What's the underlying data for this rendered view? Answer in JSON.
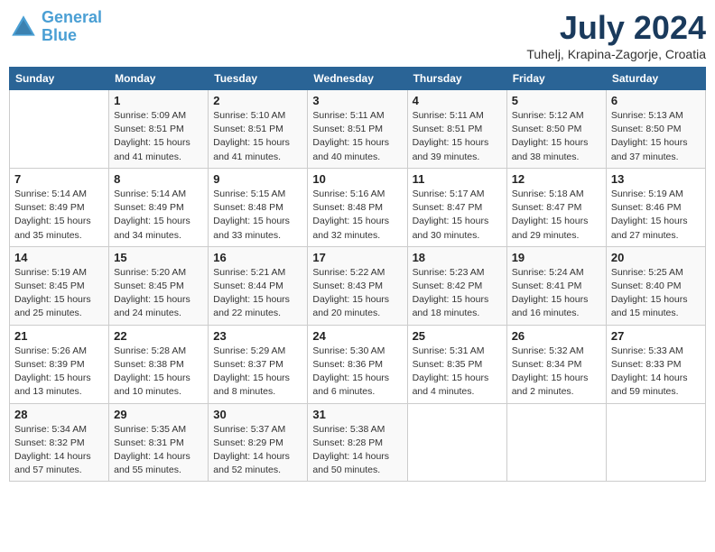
{
  "header": {
    "logo_line1": "General",
    "logo_line2": "Blue",
    "month": "July 2024",
    "location": "Tuhelj, Krapina-Zagorje, Croatia"
  },
  "days_of_week": [
    "Sunday",
    "Monday",
    "Tuesday",
    "Wednesday",
    "Thursday",
    "Friday",
    "Saturday"
  ],
  "weeks": [
    [
      {
        "day": "",
        "info": ""
      },
      {
        "day": "1",
        "info": "Sunrise: 5:09 AM\nSunset: 8:51 PM\nDaylight: 15 hours\nand 41 minutes."
      },
      {
        "day": "2",
        "info": "Sunrise: 5:10 AM\nSunset: 8:51 PM\nDaylight: 15 hours\nand 41 minutes."
      },
      {
        "day": "3",
        "info": "Sunrise: 5:11 AM\nSunset: 8:51 PM\nDaylight: 15 hours\nand 40 minutes."
      },
      {
        "day": "4",
        "info": "Sunrise: 5:11 AM\nSunset: 8:51 PM\nDaylight: 15 hours\nand 39 minutes."
      },
      {
        "day": "5",
        "info": "Sunrise: 5:12 AM\nSunset: 8:50 PM\nDaylight: 15 hours\nand 38 minutes."
      },
      {
        "day": "6",
        "info": "Sunrise: 5:13 AM\nSunset: 8:50 PM\nDaylight: 15 hours\nand 37 minutes."
      }
    ],
    [
      {
        "day": "7",
        "info": "Sunrise: 5:14 AM\nSunset: 8:49 PM\nDaylight: 15 hours\nand 35 minutes."
      },
      {
        "day": "8",
        "info": "Sunrise: 5:14 AM\nSunset: 8:49 PM\nDaylight: 15 hours\nand 34 minutes."
      },
      {
        "day": "9",
        "info": "Sunrise: 5:15 AM\nSunset: 8:48 PM\nDaylight: 15 hours\nand 33 minutes."
      },
      {
        "day": "10",
        "info": "Sunrise: 5:16 AM\nSunset: 8:48 PM\nDaylight: 15 hours\nand 32 minutes."
      },
      {
        "day": "11",
        "info": "Sunrise: 5:17 AM\nSunset: 8:47 PM\nDaylight: 15 hours\nand 30 minutes."
      },
      {
        "day": "12",
        "info": "Sunrise: 5:18 AM\nSunset: 8:47 PM\nDaylight: 15 hours\nand 29 minutes."
      },
      {
        "day": "13",
        "info": "Sunrise: 5:19 AM\nSunset: 8:46 PM\nDaylight: 15 hours\nand 27 minutes."
      }
    ],
    [
      {
        "day": "14",
        "info": "Sunrise: 5:19 AM\nSunset: 8:45 PM\nDaylight: 15 hours\nand 25 minutes."
      },
      {
        "day": "15",
        "info": "Sunrise: 5:20 AM\nSunset: 8:45 PM\nDaylight: 15 hours\nand 24 minutes."
      },
      {
        "day": "16",
        "info": "Sunrise: 5:21 AM\nSunset: 8:44 PM\nDaylight: 15 hours\nand 22 minutes."
      },
      {
        "day": "17",
        "info": "Sunrise: 5:22 AM\nSunset: 8:43 PM\nDaylight: 15 hours\nand 20 minutes."
      },
      {
        "day": "18",
        "info": "Sunrise: 5:23 AM\nSunset: 8:42 PM\nDaylight: 15 hours\nand 18 minutes."
      },
      {
        "day": "19",
        "info": "Sunrise: 5:24 AM\nSunset: 8:41 PM\nDaylight: 15 hours\nand 16 minutes."
      },
      {
        "day": "20",
        "info": "Sunrise: 5:25 AM\nSunset: 8:40 PM\nDaylight: 15 hours\nand 15 minutes."
      }
    ],
    [
      {
        "day": "21",
        "info": "Sunrise: 5:26 AM\nSunset: 8:39 PM\nDaylight: 15 hours\nand 13 minutes."
      },
      {
        "day": "22",
        "info": "Sunrise: 5:28 AM\nSunset: 8:38 PM\nDaylight: 15 hours\nand 10 minutes."
      },
      {
        "day": "23",
        "info": "Sunrise: 5:29 AM\nSunset: 8:37 PM\nDaylight: 15 hours\nand 8 minutes."
      },
      {
        "day": "24",
        "info": "Sunrise: 5:30 AM\nSunset: 8:36 PM\nDaylight: 15 hours\nand 6 minutes."
      },
      {
        "day": "25",
        "info": "Sunrise: 5:31 AM\nSunset: 8:35 PM\nDaylight: 15 hours\nand 4 minutes."
      },
      {
        "day": "26",
        "info": "Sunrise: 5:32 AM\nSunset: 8:34 PM\nDaylight: 15 hours\nand 2 minutes."
      },
      {
        "day": "27",
        "info": "Sunrise: 5:33 AM\nSunset: 8:33 PM\nDaylight: 14 hours\nand 59 minutes."
      }
    ],
    [
      {
        "day": "28",
        "info": "Sunrise: 5:34 AM\nSunset: 8:32 PM\nDaylight: 14 hours\nand 57 minutes."
      },
      {
        "day": "29",
        "info": "Sunrise: 5:35 AM\nSunset: 8:31 PM\nDaylight: 14 hours\nand 55 minutes."
      },
      {
        "day": "30",
        "info": "Sunrise: 5:37 AM\nSunset: 8:29 PM\nDaylight: 14 hours\nand 52 minutes."
      },
      {
        "day": "31",
        "info": "Sunrise: 5:38 AM\nSunset: 8:28 PM\nDaylight: 14 hours\nand 50 minutes."
      },
      {
        "day": "",
        "info": ""
      },
      {
        "day": "",
        "info": ""
      },
      {
        "day": "",
        "info": ""
      }
    ]
  ]
}
